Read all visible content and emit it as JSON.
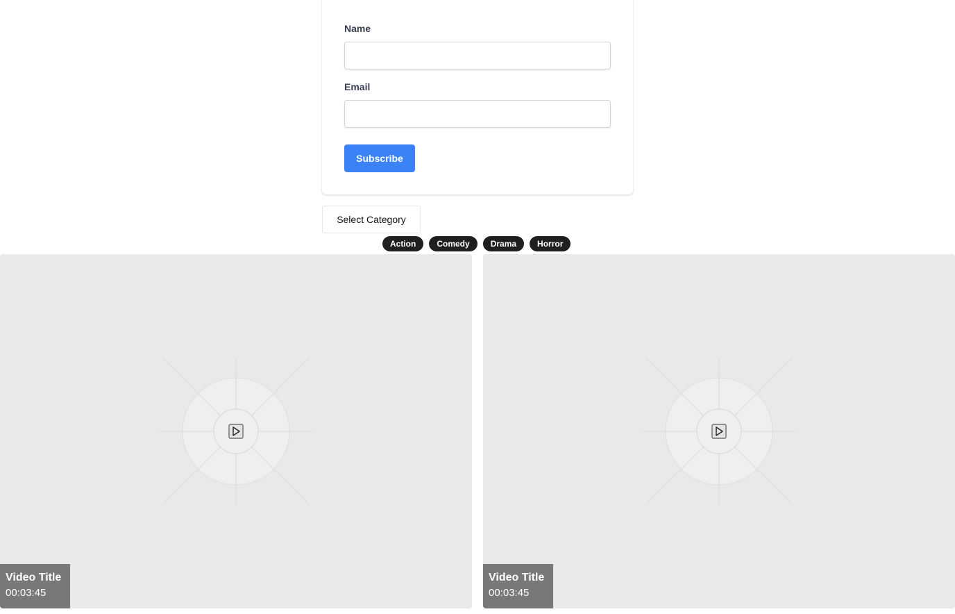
{
  "form": {
    "name_label": "Name",
    "name_value": "",
    "email_label": "Email",
    "email_value": "",
    "subscribe_label": "Subscribe"
  },
  "category_select": {
    "label": "Select Category"
  },
  "tags": [
    "Action",
    "Comedy",
    "Drama",
    "Horror"
  ],
  "videos": [
    {
      "title": "Video Title",
      "duration": "00:03:45",
      "icon": "play-icon"
    },
    {
      "title": "Video Title",
      "duration": "00:03:45",
      "icon": "play-icon"
    }
  ],
  "colors": {
    "accent": "#3b82f6",
    "tag_bg": "#1f1f1f",
    "video_bg": "#e9e9e9",
    "caption_bg": "#787878"
  }
}
